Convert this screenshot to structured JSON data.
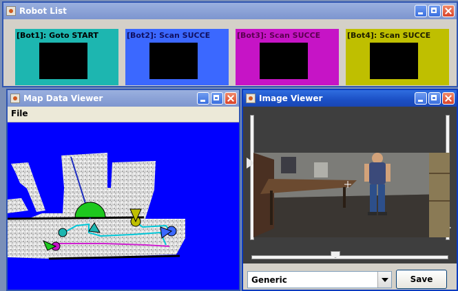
{
  "robot_list": {
    "title": "Robot List",
    "bots": [
      {
        "label": "[Bot1]: Goto START",
        "color": "#1db6b0",
        "text_color": "#000000"
      },
      {
        "label": "[Bot2]: Scan SUCCE",
        "color": "#3b68ff",
        "text_color": "#101060"
      },
      {
        "label": "[Bot3]: Scan SUCCE",
        "color": "#c614c6",
        "text_color": "#5b004f"
      },
      {
        "label": "[Bot4]: Scan SUCCE",
        "color": "#bfbf00",
        "text_color": "#202000"
      }
    ]
  },
  "map_viewer": {
    "title": "Map Data Viewer",
    "menu": {
      "file": "File"
    },
    "background": "#0000ff"
  },
  "image_viewer": {
    "title": "Image Viewer",
    "view_select": "Generic",
    "save_label": "Save"
  }
}
